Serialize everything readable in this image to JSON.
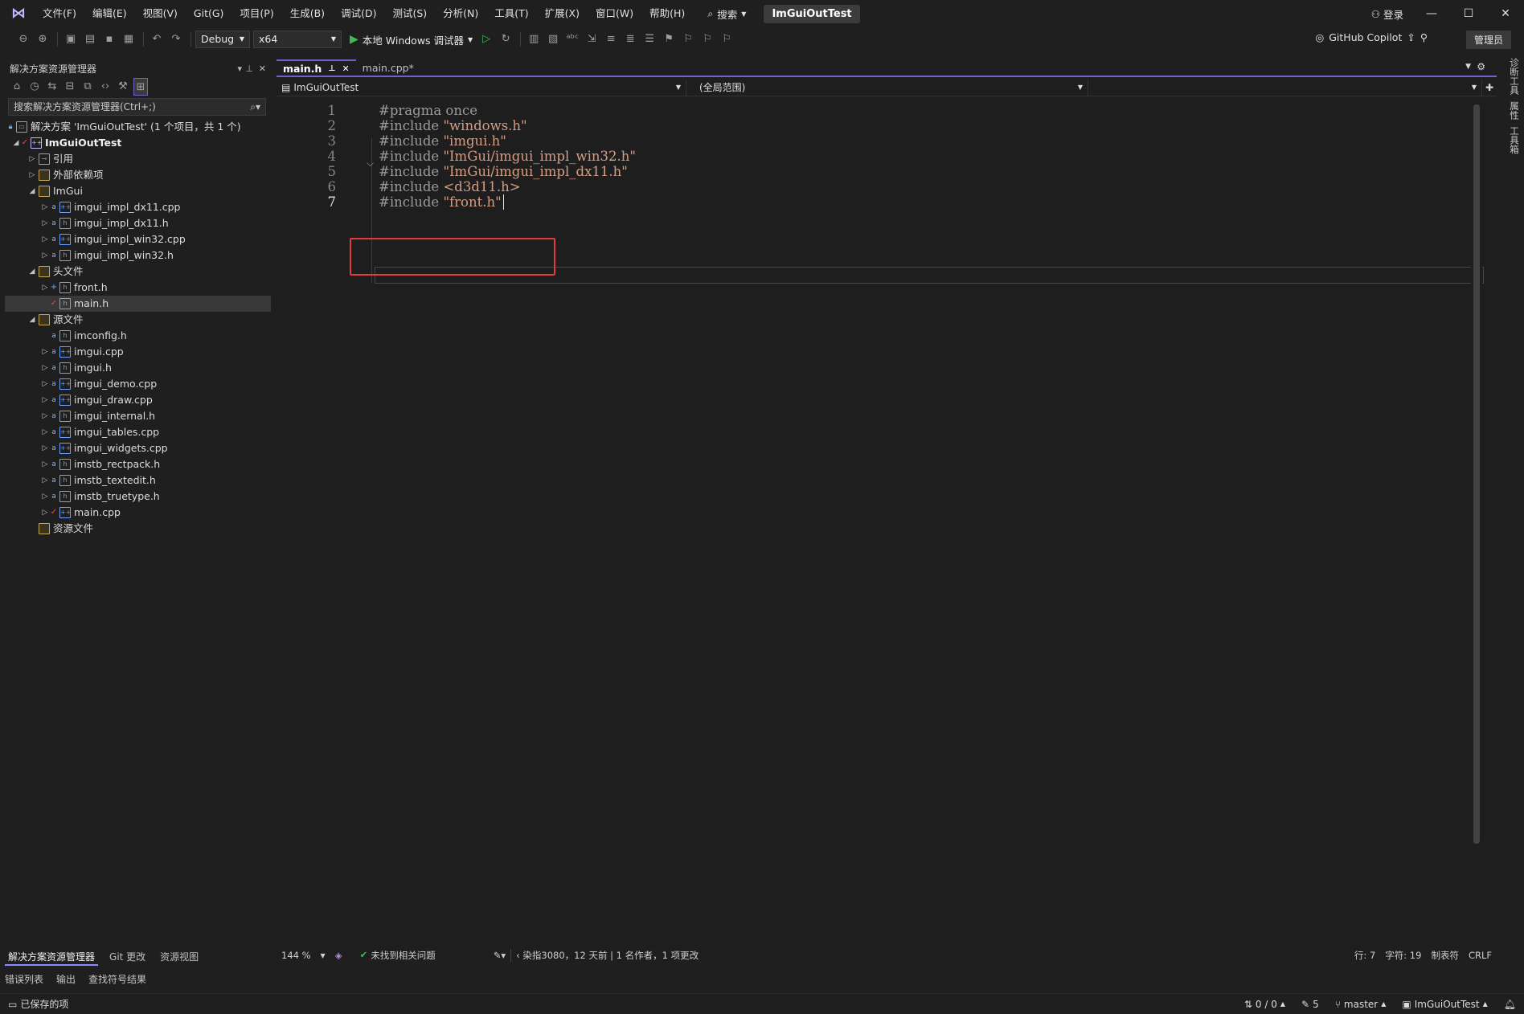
{
  "titlebar": {
    "menu": [
      "文件(F)",
      "编辑(E)",
      "视图(V)",
      "Git(G)",
      "项目(P)",
      "生成(B)",
      "调试(D)",
      "测试(S)",
      "分析(N)",
      "工具(T)",
      "扩展(X)",
      "窗口(W)",
      "帮助(H)"
    ],
    "search_label": "搜索",
    "solution_title": "ImGuiOutTest",
    "login_label": "登录"
  },
  "toolbar": {
    "config": "Debug",
    "platform": "x64",
    "run_label": "本地 Windows 调试器",
    "copilot_label": "GitHub Copilot",
    "admin_label": "管理员"
  },
  "solution_explorer": {
    "title": "解决方案资源管理器",
    "search_placeholder": "搜索解决方案资源管理器(Ctrl+;)",
    "solution_label": "解决方案 'ImGuiOutTest' (1 个项目，共 1 个)",
    "project": "ImGuiOutTest",
    "items": [
      {
        "label": "引用",
        "level": 2,
        "twisty": "▷",
        "icon": "reference-icon"
      },
      {
        "label": "外部依赖项",
        "level": 2,
        "twisty": "▷",
        "icon": "folder-icon"
      },
      {
        "label": "ImGui",
        "level": 2,
        "twisty": "◢",
        "icon": "folder-icon"
      },
      {
        "label": "imgui_impl_dx11.cpp",
        "level": 3,
        "twisty": "▷",
        "icon": "cpp-file-icon"
      },
      {
        "label": "imgui_impl_dx11.h",
        "level": 3,
        "twisty": "▷",
        "icon": "header-file-icon"
      },
      {
        "label": "imgui_impl_win32.cpp",
        "level": 3,
        "twisty": "▷",
        "icon": "cpp-file-icon"
      },
      {
        "label": "imgui_impl_win32.h",
        "level": 3,
        "twisty": "▷",
        "icon": "header-file-icon"
      },
      {
        "label": "头文件",
        "level": 2,
        "twisty": "◢",
        "icon": "folder-icon"
      },
      {
        "label": "front.h",
        "level": 3,
        "twisty": "▷",
        "icon": "header-file-icon",
        "mark": "plus"
      },
      {
        "label": "main.h",
        "level": 3,
        "twisty": "",
        "icon": "header-file-icon",
        "mark": "check",
        "selected": true
      },
      {
        "label": "源文件",
        "level": 2,
        "twisty": "◢",
        "icon": "folder-icon"
      },
      {
        "label": "imconfig.h",
        "level": 3,
        "twisty": "",
        "icon": "header-file-icon"
      },
      {
        "label": "imgui.cpp",
        "level": 3,
        "twisty": "▷",
        "icon": "cpp-file-icon"
      },
      {
        "label": "imgui.h",
        "level": 3,
        "twisty": "▷",
        "icon": "header-file-icon"
      },
      {
        "label": "imgui_demo.cpp",
        "level": 3,
        "twisty": "▷",
        "icon": "cpp-file-icon"
      },
      {
        "label": "imgui_draw.cpp",
        "level": 3,
        "twisty": "▷",
        "icon": "cpp-file-icon"
      },
      {
        "label": "imgui_internal.h",
        "level": 3,
        "twisty": "▷",
        "icon": "header-file-icon"
      },
      {
        "label": "imgui_tables.cpp",
        "level": 3,
        "twisty": "▷",
        "icon": "cpp-file-icon"
      },
      {
        "label": "imgui_widgets.cpp",
        "level": 3,
        "twisty": "▷",
        "icon": "cpp-file-icon"
      },
      {
        "label": "imstb_rectpack.h",
        "level": 3,
        "twisty": "▷",
        "icon": "header-file-icon"
      },
      {
        "label": "imstb_textedit.h",
        "level": 3,
        "twisty": "▷",
        "icon": "header-file-icon"
      },
      {
        "label": "imstb_truetype.h",
        "level": 3,
        "twisty": "▷",
        "icon": "header-file-icon"
      },
      {
        "label": "main.cpp",
        "level": 3,
        "twisty": "▷",
        "icon": "cpp-file-icon",
        "mark": "check"
      },
      {
        "label": "资源文件",
        "level": 2,
        "twisty": "",
        "icon": "folder-icon"
      }
    ],
    "bottom_tabs": [
      "解决方案资源管理器",
      "Git 更改",
      "资源视图"
    ]
  },
  "output_tabs": [
    "错误列表",
    "输出",
    "查找符号结果"
  ],
  "editor": {
    "tabs": [
      {
        "label": "main.h",
        "active": true
      },
      {
        "label": "main.cpp*",
        "active": false
      }
    ],
    "nav_project": "ImGuiOutTest",
    "nav_scope": "(全局范围)",
    "lines": [
      {
        "n": "1",
        "pre": "#pragma once",
        "str": ""
      },
      {
        "n": "2",
        "pre": "#include ",
        "str": "\"windows.h\""
      },
      {
        "n": "3",
        "pre": "#include ",
        "str": "\"imgui.h\""
      },
      {
        "n": "4",
        "pre": "#include ",
        "str": "\"ImGui/imgui_impl_win32.h\""
      },
      {
        "n": "5",
        "pre": "#include ",
        "str": "\"ImGui/imgui_impl_dx11.h\""
      },
      {
        "n": "6",
        "pre": "#include ",
        "str": "<d3d11.h>"
      },
      {
        "n": "7",
        "pre": "#include ",
        "str": "\"front.h\""
      }
    ],
    "zoom": "144 %",
    "issues": "未找到相关问题",
    "blame": "染指3080，12 天前 | 1 名作者，1 项更改",
    "line_pos": "行: 7",
    "char_pos": "字符: 19",
    "tab_mode": "制表符",
    "eol": "CRLF"
  },
  "right_tools": [
    "诊断工具",
    "属性",
    "工具箱"
  ],
  "statusbar": {
    "saved": "已保存的项",
    "sync": "0 / 0",
    "edits": "5",
    "branch": "master",
    "repo": "ImGuiOutTest"
  },
  "colors": {
    "accent": "#6f62c8",
    "highlight_box": "#e23b3b",
    "string": "#d69d85",
    "run": "#3fb950"
  }
}
